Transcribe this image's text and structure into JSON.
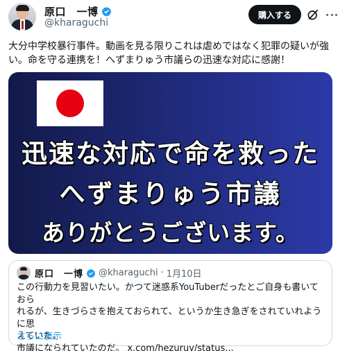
{
  "author": {
    "name": "原口　一博",
    "handle": "@kharaguchi"
  },
  "actions": {
    "buy_label": "購入する"
  },
  "post": {
    "text": "大分中学校暴行事件。動画を見る限りこれは虐めではなく犯罪の疑いが強い。命を守る連携を！へずまりゅう市議らの迅速な対応に感謝！"
  },
  "media": {
    "line1": "迅速な対応で命を救った",
    "line2": "へずまりゅう市議",
    "line3": "ありがとうございます。",
    "bg_colors": [
      "#121a4a",
      "#2c3aa8"
    ],
    "flag_color": "#e60012"
  },
  "quote": {
    "name": "原口　一博",
    "handle": "@kharaguchi",
    "separator": "·",
    "date": "1月10日",
    "text_lines": [
      "この行動力を見習いたい。かつて迷惑系YouTuberだったとご自身も書いておら",
      "れるが、生きづらさを抱えておられて、というか生き急ぎをされていれように思",
      "えていた。",
      "市議になられていたのだ。 x.com/hezuruy/status..."
    ],
    "show_more": "さらに表示"
  },
  "colors": {
    "text": "#0f1419",
    "secondary": "#536471",
    "link": "#1d9bf0",
    "verified": "#1d9bf0",
    "button_bg": "#0f1419"
  },
  "icons": [
    "verified-badge-icon",
    "grok-icon",
    "more-options-icon"
  ]
}
